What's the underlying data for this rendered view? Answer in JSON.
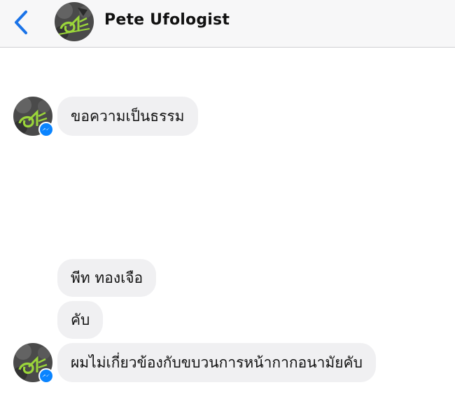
{
  "header": {
    "contact_name": "Pete Ufologist",
    "back_icon": "chevron-left-icon",
    "accent_color": "#1a73e8"
  },
  "messages": [
    {
      "text": "ขอความเป็นธรรม",
      "show_avatar": true
    },
    {
      "text": "พีท ทองเจือ",
      "show_avatar": false
    },
    {
      "text": "คับ",
      "show_avatar": false
    },
    {
      "text": "ผมไม่เกี่ยวข้องกับขบวนการหน้ากากอนามัยคับ",
      "show_avatar": true
    }
  ],
  "colors": {
    "bubble": "#f0f0f2",
    "header_bg": "#f7f7f8",
    "messenger_badge": "#0a84ff",
    "avatar_logo": "#9bd63a"
  }
}
